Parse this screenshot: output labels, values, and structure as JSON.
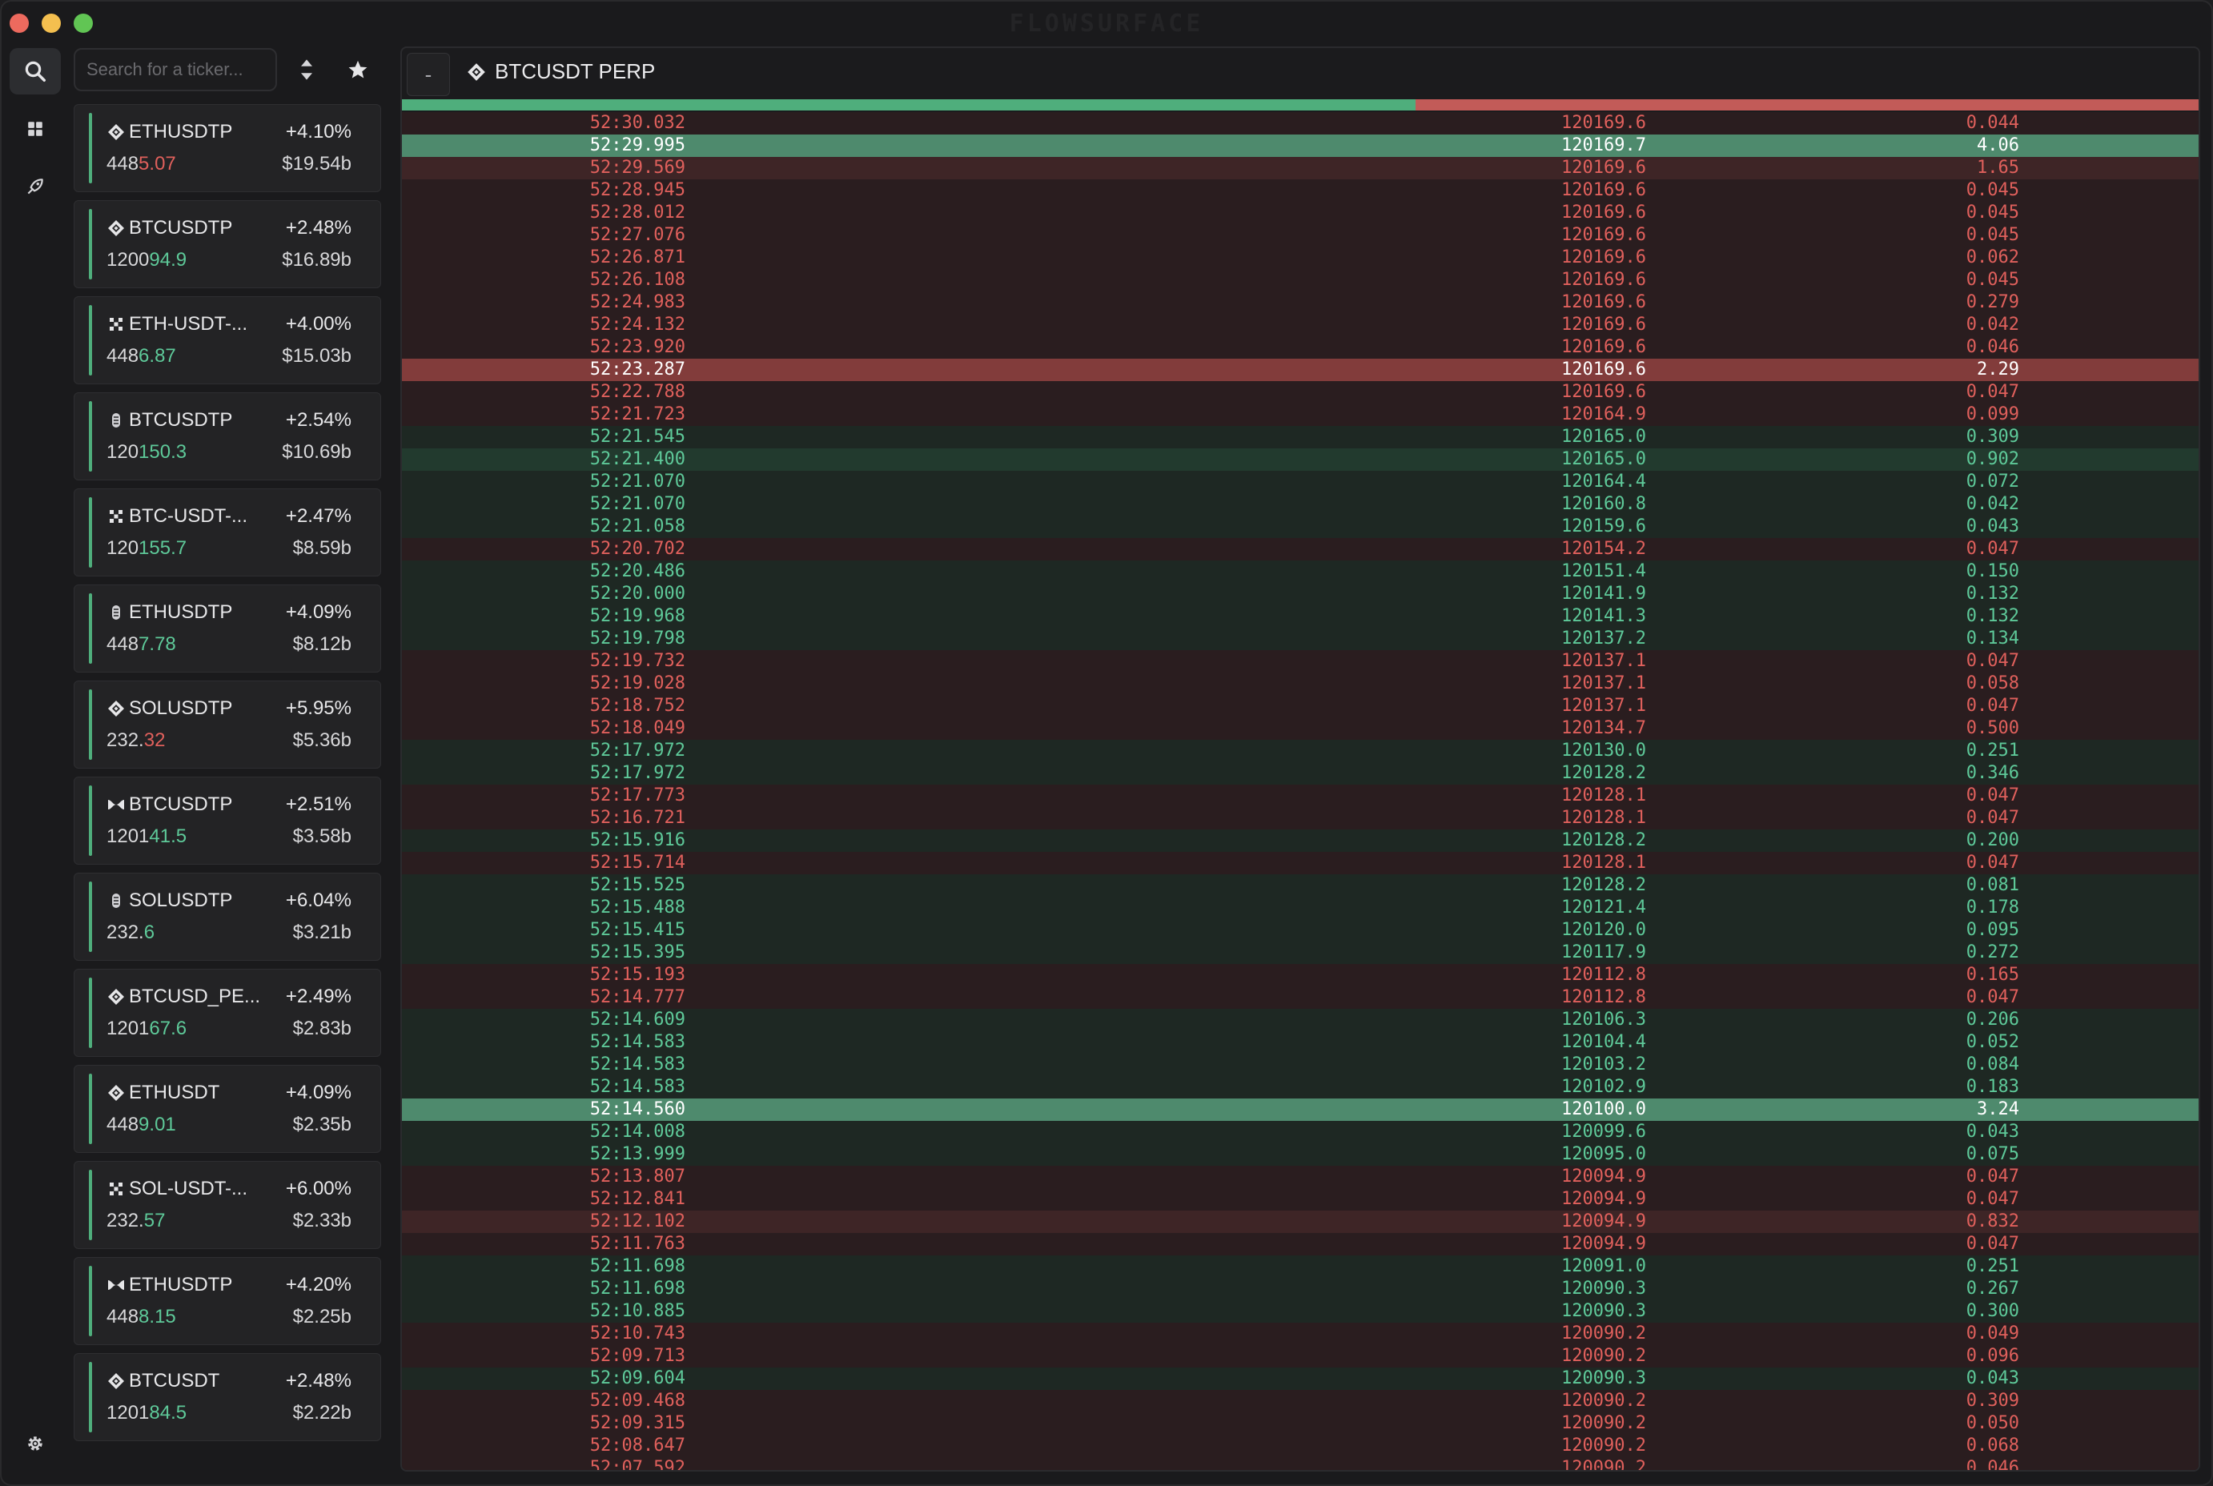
{
  "app": {
    "title": "FLOWSURFACE"
  },
  "sidebar": {
    "search_placeholder": "Search for a ticker...",
    "tickers": [
      {
        "exchange": "binance",
        "symbol": "ETHUSDTP",
        "change": "+4.10%",
        "price_prefix": "448",
        "price_suffix": "5.07",
        "direction": "down",
        "volume": "$19.54b"
      },
      {
        "exchange": "binance",
        "symbol": "BTCUSDTP",
        "change": "+2.48%",
        "price_prefix": "1200",
        "price_suffix": "94.9",
        "direction": "up",
        "volume": "$16.89b"
      },
      {
        "exchange": "okx",
        "symbol": "ETH-USDT-...",
        "change": "+4.00%",
        "price_prefix": "448",
        "price_suffix": "6.87",
        "direction": "up",
        "volume": "$15.03b"
      },
      {
        "exchange": "bybit",
        "symbol": "BTCUSDTP",
        "change": "+2.54%",
        "price_prefix": "120",
        "price_suffix": "150.3",
        "direction": "up",
        "volume": "$10.69b"
      },
      {
        "exchange": "okx",
        "symbol": "BTC-USDT-...",
        "change": "+2.47%",
        "price_prefix": "120",
        "price_suffix": "155.7",
        "direction": "up",
        "volume": "$8.59b"
      },
      {
        "exchange": "bybit",
        "symbol": "ETHUSDTP",
        "change": "+4.09%",
        "price_prefix": "448",
        "price_suffix": "7.78",
        "direction": "up",
        "volume": "$8.12b"
      },
      {
        "exchange": "binance",
        "symbol": "SOLUSDTP",
        "change": "+5.95%",
        "price_prefix": "232.",
        "price_suffix": "32",
        "direction": "down",
        "volume": "$5.36b"
      },
      {
        "exchange": "hyperliquid",
        "symbol": "BTCUSDTP",
        "change": "+2.51%",
        "price_prefix": "1201",
        "price_suffix": "41.5",
        "direction": "up",
        "volume": "$3.58b"
      },
      {
        "exchange": "bybit",
        "symbol": "SOLUSDTP",
        "change": "+6.04%",
        "price_prefix": "232.",
        "price_suffix": "6",
        "direction": "up",
        "volume": "$3.21b"
      },
      {
        "exchange": "binance",
        "symbol": "BTCUSD_PE...",
        "change": "+2.49%",
        "price_prefix": "1201",
        "price_suffix": "67.6",
        "direction": "up",
        "volume": "$2.83b"
      },
      {
        "exchange": "binance",
        "symbol": "ETHUSDT",
        "change": "+4.09%",
        "price_prefix": "448",
        "price_suffix": "9.01",
        "direction": "up",
        "volume": "$2.35b"
      },
      {
        "exchange": "okx",
        "symbol": "SOL-USDT-...",
        "change": "+6.00%",
        "price_prefix": "232.",
        "price_suffix": "57",
        "direction": "up",
        "volume": "$2.33b"
      },
      {
        "exchange": "hyperliquid",
        "symbol": "ETHUSDTP",
        "change": "+4.20%",
        "price_prefix": "448",
        "price_suffix": "8.15",
        "direction": "up",
        "volume": "$2.25b"
      },
      {
        "exchange": "binance",
        "symbol": "BTCUSDT",
        "change": "+2.48%",
        "price_prefix": "1201",
        "price_suffix": "84.5",
        "direction": "up",
        "volume": "$2.22b"
      }
    ]
  },
  "pane": {
    "collapse_label": "-",
    "title": "BTCUSDT PERP",
    "buy_ratio": 0.564,
    "colors": {
      "buy": "#4fae7c",
      "sell": "#c25b58"
    },
    "trades": [
      {
        "time": "52:30.032",
        "price": "120169.6",
        "qty": "0.044",
        "side": "sell"
      },
      {
        "time": "52:29.995",
        "price": "120169.7",
        "qty": "4.06",
        "side": "buy",
        "emph": "hl"
      },
      {
        "time": "52:29.569",
        "price": "120169.6",
        "qty": "1.65",
        "side": "sell",
        "emph": "md"
      },
      {
        "time": "52:28.945",
        "price": "120169.6",
        "qty": "0.045",
        "side": "sell"
      },
      {
        "time": "52:28.012",
        "price": "120169.6",
        "qty": "0.045",
        "side": "sell"
      },
      {
        "time": "52:27.076",
        "price": "120169.6",
        "qty": "0.045",
        "side": "sell"
      },
      {
        "time": "52:26.871",
        "price": "120169.6",
        "qty": "0.062",
        "side": "sell"
      },
      {
        "time": "52:26.108",
        "price": "120169.6",
        "qty": "0.045",
        "side": "sell"
      },
      {
        "time": "52:24.983",
        "price": "120169.6",
        "qty": "0.279",
        "side": "sell"
      },
      {
        "time": "52:24.132",
        "price": "120169.6",
        "qty": "0.042",
        "side": "sell"
      },
      {
        "time": "52:23.920",
        "price": "120169.6",
        "qty": "0.046",
        "side": "sell"
      },
      {
        "time": "52:23.287",
        "price": "120169.6",
        "qty": "2.29",
        "side": "sell",
        "emph": "hl"
      },
      {
        "time": "52:22.788",
        "price": "120169.6",
        "qty": "0.047",
        "side": "sell"
      },
      {
        "time": "52:21.723",
        "price": "120164.9",
        "qty": "0.099",
        "side": "sell"
      },
      {
        "time": "52:21.545",
        "price": "120165.0",
        "qty": "0.309",
        "side": "buy"
      },
      {
        "time": "52:21.400",
        "price": "120165.0",
        "qty": "0.902",
        "side": "buy",
        "emph": "md"
      },
      {
        "time": "52:21.070",
        "price": "120164.4",
        "qty": "0.072",
        "side": "buy"
      },
      {
        "time": "52:21.070",
        "price": "120160.8",
        "qty": "0.042",
        "side": "buy"
      },
      {
        "time": "52:21.058",
        "price": "120159.6",
        "qty": "0.043",
        "side": "buy"
      },
      {
        "time": "52:20.702",
        "price": "120154.2",
        "qty": "0.047",
        "side": "sell"
      },
      {
        "time": "52:20.486",
        "price": "120151.4",
        "qty": "0.150",
        "side": "buy"
      },
      {
        "time": "52:20.000",
        "price": "120141.9",
        "qty": "0.132",
        "side": "buy"
      },
      {
        "time": "52:19.968",
        "price": "120141.3",
        "qty": "0.132",
        "side": "buy"
      },
      {
        "time": "52:19.798",
        "price": "120137.2",
        "qty": "0.134",
        "side": "buy"
      },
      {
        "time": "52:19.732",
        "price": "120137.1",
        "qty": "0.047",
        "side": "sell"
      },
      {
        "time": "52:19.028",
        "price": "120137.1",
        "qty": "0.058",
        "side": "sell"
      },
      {
        "time": "52:18.752",
        "price": "120137.1",
        "qty": "0.047",
        "side": "sell"
      },
      {
        "time": "52:18.049",
        "price": "120134.7",
        "qty": "0.500",
        "side": "sell"
      },
      {
        "time": "52:17.972",
        "price": "120130.0",
        "qty": "0.251",
        "side": "buy"
      },
      {
        "time": "52:17.972",
        "price": "120128.2",
        "qty": "0.346",
        "side": "buy"
      },
      {
        "time": "52:17.773",
        "price": "120128.1",
        "qty": "0.047",
        "side": "sell"
      },
      {
        "time": "52:16.721",
        "price": "120128.1",
        "qty": "0.047",
        "side": "sell"
      },
      {
        "time": "52:15.916",
        "price": "120128.2",
        "qty": "0.200",
        "side": "buy"
      },
      {
        "time": "52:15.714",
        "price": "120128.1",
        "qty": "0.047",
        "side": "sell"
      },
      {
        "time": "52:15.525",
        "price": "120128.2",
        "qty": "0.081",
        "side": "buy"
      },
      {
        "time": "52:15.488",
        "price": "120121.4",
        "qty": "0.178",
        "side": "buy"
      },
      {
        "time": "52:15.415",
        "price": "120120.0",
        "qty": "0.095",
        "side": "buy"
      },
      {
        "time": "52:15.395",
        "price": "120117.9",
        "qty": "0.272",
        "side": "buy"
      },
      {
        "time": "52:15.193",
        "price": "120112.8",
        "qty": "0.165",
        "side": "sell"
      },
      {
        "time": "52:14.777",
        "price": "120112.8",
        "qty": "0.047",
        "side": "sell"
      },
      {
        "time": "52:14.609",
        "price": "120106.3",
        "qty": "0.206",
        "side": "buy"
      },
      {
        "time": "52:14.583",
        "price": "120104.4",
        "qty": "0.052",
        "side": "buy"
      },
      {
        "time": "52:14.583",
        "price": "120103.2",
        "qty": "0.084",
        "side": "buy"
      },
      {
        "time": "52:14.583",
        "price": "120102.9",
        "qty": "0.183",
        "side": "buy"
      },
      {
        "time": "52:14.560",
        "price": "120100.0",
        "qty": "3.24",
        "side": "buy",
        "emph": "hl"
      },
      {
        "time": "52:14.008",
        "price": "120099.6",
        "qty": "0.043",
        "side": "buy"
      },
      {
        "time": "52:13.999",
        "price": "120095.0",
        "qty": "0.075",
        "side": "buy"
      },
      {
        "time": "52:13.807",
        "price": "120094.9",
        "qty": "0.047",
        "side": "sell"
      },
      {
        "time": "52:12.841",
        "price": "120094.9",
        "qty": "0.047",
        "side": "sell"
      },
      {
        "time": "52:12.102",
        "price": "120094.9",
        "qty": "0.832",
        "side": "sell",
        "emph": "md"
      },
      {
        "time": "52:11.763",
        "price": "120094.9",
        "qty": "0.047",
        "side": "sell"
      },
      {
        "time": "52:11.698",
        "price": "120091.0",
        "qty": "0.251",
        "side": "buy"
      },
      {
        "time": "52:11.698",
        "price": "120090.3",
        "qty": "0.267",
        "side": "buy"
      },
      {
        "time": "52:10.885",
        "price": "120090.3",
        "qty": "0.300",
        "side": "buy"
      },
      {
        "time": "52:10.743",
        "price": "120090.2",
        "qty": "0.049",
        "side": "sell"
      },
      {
        "time": "52:09.713",
        "price": "120090.2",
        "qty": "0.096",
        "side": "sell"
      },
      {
        "time": "52:09.604",
        "price": "120090.3",
        "qty": "0.043",
        "side": "buy"
      },
      {
        "time": "52:09.468",
        "price": "120090.2",
        "qty": "0.309",
        "side": "sell"
      },
      {
        "time": "52:09.315",
        "price": "120090.2",
        "qty": "0.050",
        "side": "sell"
      },
      {
        "time": "52:08.647",
        "price": "120090.2",
        "qty": "0.068",
        "side": "sell"
      },
      {
        "time": "52:07.592",
        "price": "120090.2",
        "qty": "0.046",
        "side": "sell"
      }
    ]
  }
}
